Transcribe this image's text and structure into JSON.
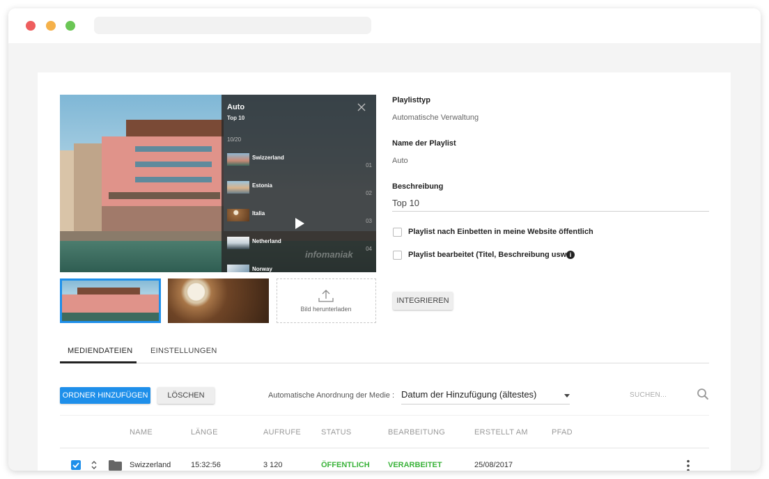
{
  "player": {
    "overlay_title": "Auto",
    "overlay_subtitle": "Top 10",
    "counter": "10/20",
    "items": [
      {
        "name": "Swizzerland",
        "num": "01"
      },
      {
        "name": "Estonia",
        "num": "02"
      },
      {
        "name": "Italia",
        "num": "03"
      },
      {
        "name": "Netherland",
        "num": "04"
      },
      {
        "name": "Norway",
        "num": ""
      }
    ],
    "watermark": "infomaniak"
  },
  "upload": {
    "label": "Bild herunterladen"
  },
  "form": {
    "type_label": "Playlisttyp",
    "type_value": "Automatische Verwaltung",
    "name_label": "Name der Playlist",
    "name_value": "Auto",
    "desc_label": "Beschreibung",
    "desc_value": "Top 10",
    "check1": "Playlist nach Einbetten in meine Website öffentlich",
    "check2": "Playlist bearbeitet (Titel, Beschreibung usw.)",
    "integrate_button": "INTEGRIEREN"
  },
  "tabs": [
    {
      "label": "MEDIENDATEIEN",
      "active": true
    },
    {
      "label": "EINSTELLUNGEN",
      "active": false
    }
  ],
  "toolbar": {
    "add_folder": "ORDNER HINZUFÜGEN",
    "delete": "LÖSCHEN",
    "sort_label": "Automatische Anordnung der Medie :",
    "sort_value": "Datum der Hinzufügung (ältestes)",
    "search_placeholder": "SUCHEN..."
  },
  "table": {
    "headers": [
      "NAME",
      "LÄNGE",
      "AUFRUFE",
      "STATUS",
      "BEARBEITUNG",
      "ERSTELLT AM",
      "PFAD"
    ],
    "rows": [
      {
        "name": "Swizzerland",
        "length": "15:32:56",
        "views": "3 120",
        "status": "ÖFFENTLICH",
        "processing": "VERARBEITET",
        "created": "25/08/2017",
        "path": ""
      }
    ]
  },
  "colors": {
    "accent": "#1e8fea",
    "status_green": "#3bb33b"
  }
}
